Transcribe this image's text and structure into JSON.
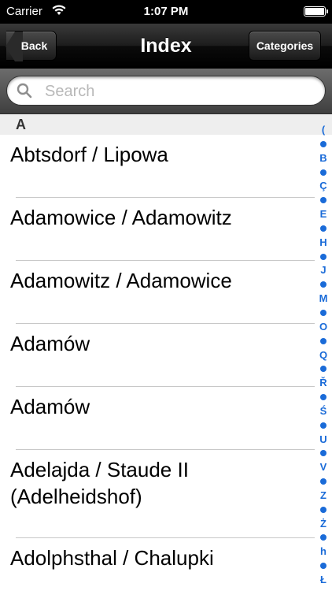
{
  "statusbar": {
    "carrier": "Carrier",
    "time": "1:07 PM"
  },
  "navbar": {
    "title": "Index",
    "back_label": "Back",
    "categories_label": "Categories"
  },
  "search": {
    "placeholder": "Search"
  },
  "section": {
    "letter": "A"
  },
  "rows": [
    {
      "label": "Abtsdorf / Lipowa"
    },
    {
      "label": "Adamowice / Adamowitz"
    },
    {
      "label": "Adamowitz / Adamowice"
    },
    {
      "label": "Adamów"
    },
    {
      "label": "Adamów"
    },
    {
      "label": "Adelajda / Staude II (Adelheidshof)"
    },
    {
      "label": "Adolphsthal / Chalupki"
    }
  ],
  "index": [
    "(",
    "•",
    "B",
    "•",
    "Ç",
    "•",
    "E",
    "•",
    "H",
    "•",
    "J",
    "•",
    "M",
    "•",
    "O",
    "•",
    "Q",
    "•",
    "Ř",
    "•",
    "Ś",
    "•",
    "U",
    "•",
    "V",
    "•",
    "Z",
    "•",
    "Ż",
    "•",
    "h",
    "•",
    "Ł"
  ],
  "colors": {
    "index_accent": "#1a6bd8"
  }
}
